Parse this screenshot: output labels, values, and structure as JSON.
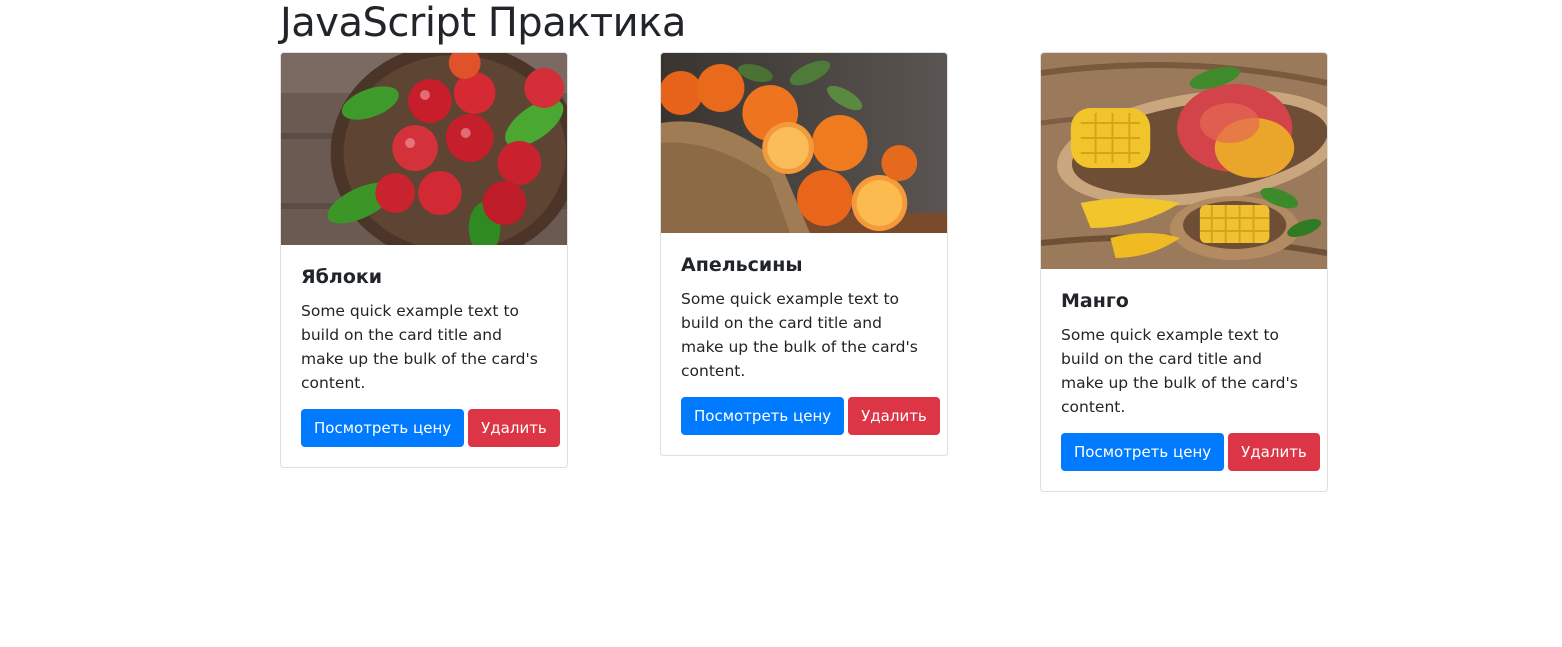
{
  "page": {
    "title": "JavaScript Практика"
  },
  "cards": [
    {
      "title": "Яблоки",
      "text": "Some quick example text to build on the card title and make up the bulk of the card's content.",
      "image": "apples-photo",
      "price_button": "Посмотреть цену",
      "delete_button": "Удалить"
    },
    {
      "title": "Апельсины",
      "text": "Some quick example text to build on the card title and make up the bulk of the card's content.",
      "image": "oranges-photo",
      "price_button": "Посмотреть цену",
      "delete_button": "Удалить"
    },
    {
      "title": "Манго",
      "text": "Some quick example text to build on the card title and make up the bulk of the card's content.",
      "image": "mango-photo",
      "price_button": "Посмотреть цену",
      "delete_button": "Удалить"
    }
  ],
  "colors": {
    "primary": "#007bff",
    "danger": "#dc3545",
    "text": "#212529"
  }
}
